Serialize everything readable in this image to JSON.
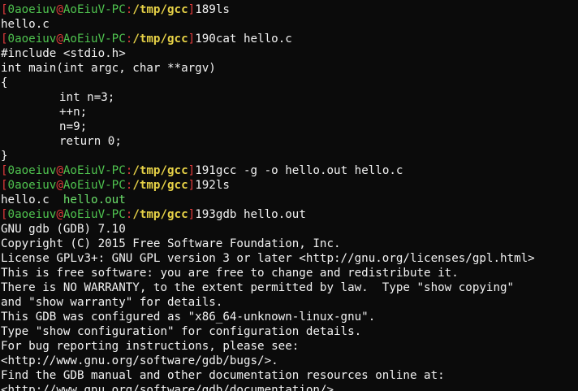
{
  "prompt": {
    "open": "[",
    "user": "0aoeiuv",
    "at": "@",
    "host": "AoEiuV-PC",
    "colon": ":",
    "path": "/tmp/gcc",
    "close": "]"
  },
  "commands": [
    {
      "num": "189",
      "cmd": "ls"
    },
    {
      "num": "190",
      "cmd": "cat hello.c"
    },
    {
      "num": "191",
      "cmd": "gcc -g -o hello.out hello.c"
    },
    {
      "num": "192",
      "cmd": "ls"
    },
    {
      "num": "193",
      "cmd": "gdb hello.out"
    }
  ],
  "ls1_output": "hello.c",
  "code_lines": [
    "#include <stdio.h>",
    "int main(int argc, char **argv)",
    "{",
    "\tint n=3;",
    "\t++n;",
    "\tn=9;",
    "\treturn 0;",
    "}"
  ],
  "ls2_output": {
    "plain": "hello.c",
    "exec": "hello.out"
  },
  "gdb_output": [
    "GNU gdb (GDB) 7.10",
    "Copyright (C) 2015 Free Software Foundation, Inc.",
    "License GPLv3+: GNU GPL version 3 or later <http://gnu.org/licenses/gpl.html>",
    "This is free software: you are free to change and redistribute it.",
    "There is NO WARRANTY, to the extent permitted by law.  Type \"show copying\"",
    "and \"show warranty\" for details.",
    "This GDB was configured as \"x86_64-unknown-linux-gnu\".",
    "Type \"show configuration\" for configuration details.",
    "For bug reporting instructions, please see:",
    "<http://www.gnu.org/software/gdb/bugs/>.",
    "Find the GDB manual and other documentation resources online at:",
    "<http://www.gnu.org/software/gdb/documentation/>."
  ],
  "colors": {
    "background": "#0b0b0b",
    "bracket_red": "#e03b3b",
    "user_green": "#4fc34f",
    "path_yellow": "#e7d247",
    "text": "#f2f2f2"
  }
}
